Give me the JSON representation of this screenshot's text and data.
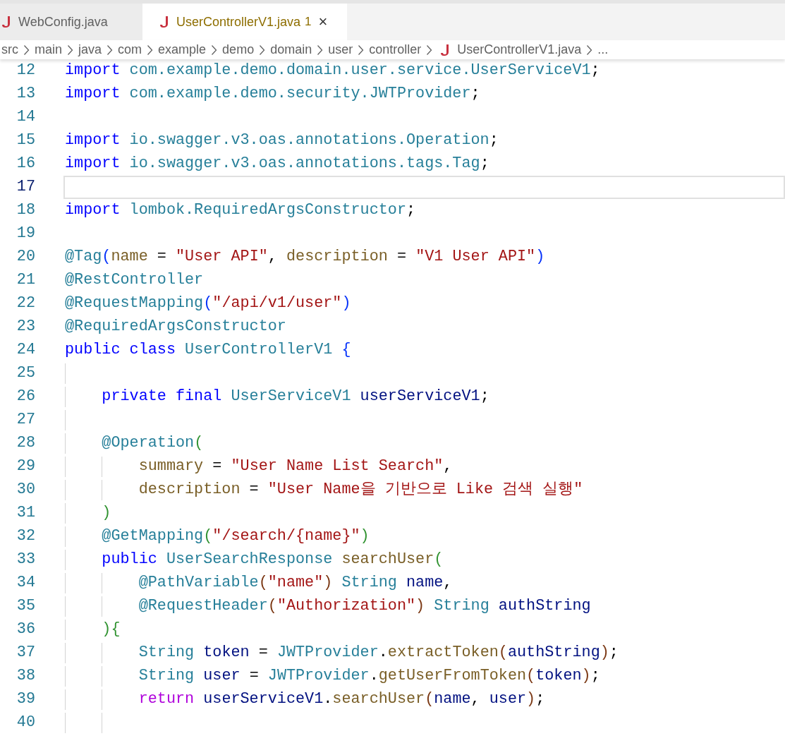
{
  "tabs": [
    {
      "label": "WebConfig.java",
      "selected": false
    },
    {
      "label": "UserControllerV1.java",
      "problems": "1",
      "selected": true,
      "close": "×"
    }
  ],
  "breadcrumb": [
    {
      "label": "src",
      "kind": "folder"
    },
    {
      "label": "main",
      "kind": "folder"
    },
    {
      "label": "java",
      "kind": "folder"
    },
    {
      "label": "com",
      "kind": "folder"
    },
    {
      "label": "example",
      "kind": "folder"
    },
    {
      "label": "demo",
      "kind": "folder"
    },
    {
      "label": "domain",
      "kind": "folder"
    },
    {
      "label": "user",
      "kind": "folder"
    },
    {
      "label": "controller",
      "kind": "folder"
    },
    {
      "label": "UserControllerV1.java",
      "kind": "file"
    },
    {
      "label": "...",
      "kind": "more"
    }
  ],
  "lines": [
    {
      "number": "12",
      "current": false,
      "tokens": [
        {
          "text": "import ",
          "kind": "kw"
        },
        {
          "text": "com.example.demo.domain.user.service.UserServiceV1",
          "kind": "type"
        },
        {
          "text": ";",
          "kind": "punc"
        }
      ]
    },
    {
      "number": "13",
      "current": false,
      "tokens": [
        {
          "text": "import ",
          "kind": "kw"
        },
        {
          "text": "com.example.demo.security.JWTProvider",
          "kind": "type"
        },
        {
          "text": ";",
          "kind": "punc"
        }
      ]
    },
    {
      "number": "14",
      "current": false
    },
    {
      "number": "15",
      "current": false,
      "tokens": [
        {
          "text": "import ",
          "kind": "kw"
        },
        {
          "text": "io.swagger.v3.oas.annotations.Operation",
          "kind": "type"
        },
        {
          "text": ";",
          "kind": "punc"
        }
      ]
    },
    {
      "number": "16",
      "current": false,
      "tokens": [
        {
          "text": "import ",
          "kind": "kw"
        },
        {
          "text": "io.swagger.v3.oas.annotations.tags.Tag",
          "kind": "type"
        },
        {
          "text": ";",
          "kind": "punc"
        }
      ]
    },
    {
      "number": "17",
      "current": true
    },
    {
      "number": "18",
      "current": false,
      "tokens": [
        {
          "text": "import ",
          "kind": "kw"
        },
        {
          "text": "lombok.RequiredArgsConstructor",
          "kind": "type"
        },
        {
          "text": ";",
          "kind": "punc"
        }
      ]
    },
    {
      "number": "19",
      "current": false
    },
    {
      "number": "20",
      "current": false,
      "tokens": [
        {
          "text": "@Tag",
          "kind": "type"
        },
        {
          "text": "(",
          "kind": "b1"
        },
        {
          "text": "name",
          "kind": "fn"
        },
        {
          "text": " = ",
          "kind": "punc"
        },
        {
          "text": "\"User API\"",
          "kind": "str"
        },
        {
          "text": ", ",
          "kind": "punc"
        },
        {
          "text": "description",
          "kind": "fn"
        },
        {
          "text": " = ",
          "kind": "punc"
        },
        {
          "text": "\"V1 User API\"",
          "kind": "str"
        },
        {
          "text": ")",
          "kind": "b1"
        }
      ]
    },
    {
      "number": "21",
      "current": false,
      "tokens": [
        {
          "text": "@RestController",
          "kind": "type"
        }
      ]
    },
    {
      "number": "22",
      "current": false,
      "tokens": [
        {
          "text": "@RequestMapping",
          "kind": "type"
        },
        {
          "text": "(",
          "kind": "b1"
        },
        {
          "text": "\"/api/v1/user\"",
          "kind": "str"
        },
        {
          "text": ")",
          "kind": "b1"
        }
      ]
    },
    {
      "number": "23",
      "current": false,
      "tokens": [
        {
          "text": "@RequiredArgsConstructor",
          "kind": "type"
        }
      ]
    },
    {
      "number": "24",
      "current": false,
      "tokens": [
        {
          "text": "public class ",
          "kind": "kw"
        },
        {
          "text": "UserControllerV1 ",
          "kind": "type"
        },
        {
          "text": "{",
          "kind": "b1"
        }
      ]
    },
    {
      "number": "25",
      "current": false
    },
    {
      "number": "26",
      "current": false,
      "tokens": [
        {
          "text": "    private final ",
          "kind": "kw"
        },
        {
          "text": "UserServiceV1 ",
          "kind": "type"
        },
        {
          "text": "userServiceV1",
          "kind": "var"
        },
        {
          "text": ";",
          "kind": "punc"
        }
      ]
    },
    {
      "number": "27",
      "current": false
    },
    {
      "number": "28",
      "current": false,
      "tokens": [
        {
          "text": "    @Operation",
          "kind": "type"
        },
        {
          "text": "(",
          "kind": "b2"
        }
      ]
    },
    {
      "number": "29",
      "current": false,
      "tokens": [
        {
          "text": "        summary",
          "kind": "fn"
        },
        {
          "text": " = ",
          "kind": "punc"
        },
        {
          "text": "\"User Name List Search\"",
          "kind": "str"
        },
        {
          "text": ",",
          "kind": "punc"
        }
      ]
    },
    {
      "number": "30",
      "current": false,
      "tokens": [
        {
          "text": "        description",
          "kind": "fn"
        },
        {
          "text": " = ",
          "kind": "punc"
        },
        {
          "text": "\"User Name을 기반으로 Like 검색 실행\"",
          "kind": "str"
        }
      ]
    },
    {
      "number": "31",
      "current": false,
      "tokens": [
        {
          "text": "    )",
          "kind": "b2"
        }
      ]
    },
    {
      "number": "32",
      "current": false,
      "tokens": [
        {
          "text": "    @GetMapping",
          "kind": "type"
        },
        {
          "text": "(",
          "kind": "b2"
        },
        {
          "text": "\"/search/{name}\"",
          "kind": "str"
        },
        {
          "text": ")",
          "kind": "b2"
        }
      ]
    },
    {
      "number": "33",
      "current": false,
      "tokens": [
        {
          "text": "    public ",
          "kind": "kw"
        },
        {
          "text": "UserSearchResponse ",
          "kind": "type"
        },
        {
          "text": "searchUser",
          "kind": "fn"
        },
        {
          "text": "(",
          "kind": "b2"
        }
      ]
    },
    {
      "number": "34",
      "current": false,
      "tokens": [
        {
          "text": "        @PathVariable",
          "kind": "type"
        },
        {
          "text": "(",
          "kind": "b3"
        },
        {
          "text": "\"name\"",
          "kind": "str"
        },
        {
          "text": ") ",
          "kind": "b3"
        },
        {
          "text": "String ",
          "kind": "type"
        },
        {
          "text": "name",
          "kind": "var"
        },
        {
          "text": ",",
          "kind": "punc"
        }
      ]
    },
    {
      "number": "35",
      "current": false,
      "tokens": [
        {
          "text": "        @RequestHeader",
          "kind": "type"
        },
        {
          "text": "(",
          "kind": "b3"
        },
        {
          "text": "\"Authorization\"",
          "kind": "str"
        },
        {
          "text": ") ",
          "kind": "b3"
        },
        {
          "text": "String ",
          "kind": "type"
        },
        {
          "text": "authString",
          "kind": "var"
        }
      ]
    },
    {
      "number": "36",
      "current": false,
      "tokens": [
        {
          "text": "    ){",
          "kind": "b2"
        }
      ]
    },
    {
      "number": "37",
      "current": false,
      "tokens": [
        {
          "text": "        String ",
          "kind": "type"
        },
        {
          "text": "token",
          "kind": "var"
        },
        {
          "text": " = ",
          "kind": "punc"
        },
        {
          "text": "JWTProvider",
          "kind": "type"
        },
        {
          "text": ".",
          "kind": "punc"
        },
        {
          "text": "extractToken",
          "kind": "fn"
        },
        {
          "text": "(",
          "kind": "b3"
        },
        {
          "text": "authString",
          "kind": "var"
        },
        {
          "text": ")",
          "kind": "b3"
        },
        {
          "text": ";",
          "kind": "punc"
        }
      ]
    },
    {
      "number": "38",
      "current": false,
      "tokens": [
        {
          "text": "        String ",
          "kind": "type"
        },
        {
          "text": "user",
          "kind": "var"
        },
        {
          "text": " = ",
          "kind": "punc"
        },
        {
          "text": "JWTProvider",
          "kind": "type"
        },
        {
          "text": ".",
          "kind": "punc"
        },
        {
          "text": "getUserFromToken",
          "kind": "fn"
        },
        {
          "text": "(",
          "kind": "b3"
        },
        {
          "text": "token",
          "kind": "var"
        },
        {
          "text": ")",
          "kind": "b3"
        },
        {
          "text": ";",
          "kind": "punc"
        }
      ]
    },
    {
      "number": "39",
      "current": false,
      "tokens": [
        {
          "text": "        return ",
          "kind": "ctl"
        },
        {
          "text": "userServiceV1",
          "kind": "var"
        },
        {
          "text": ".",
          "kind": "punc"
        },
        {
          "text": "searchUser",
          "kind": "fn"
        },
        {
          "text": "(",
          "kind": "b3"
        },
        {
          "text": "name",
          "kind": "var"
        },
        {
          "text": ", ",
          "kind": "punc"
        },
        {
          "text": "user",
          "kind": "var"
        },
        {
          "text": ")",
          "kind": "b3"
        },
        {
          "text": ";",
          "kind": "punc"
        }
      ]
    },
    {
      "number": "40",
      "current": false
    }
  ]
}
